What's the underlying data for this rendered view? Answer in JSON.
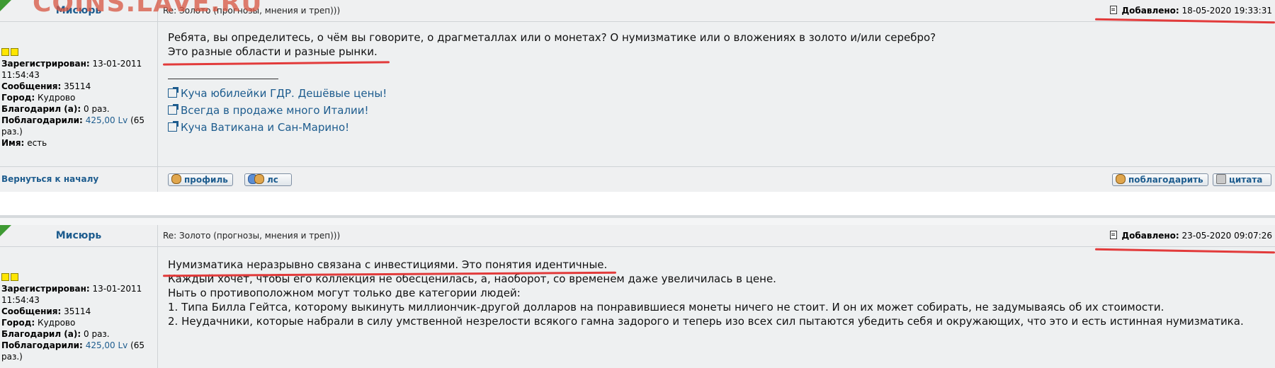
{
  "watermark": {
    "text": "COINS.LAVE.RU"
  },
  "posts": [
    {
      "author": "Мисюрь",
      "subject": "Re: Золото (прогнозы, мнения и треп)))",
      "date_label": "Добавлено:",
      "date": "18-05-2020 19:33:31",
      "profile": {
        "registered_label": "Зарегистрирован:",
        "registered_date": "13-01-2011",
        "registered_time": "11:54:43",
        "messages_label": "Сообщения:",
        "messages": "35114",
        "city_label": "Город:",
        "city": "Кудрово",
        "thanked_label": "Благодарил (а):",
        "thanked": "0 раз.",
        "was_thanked_label": "Поблагодарили:",
        "was_thanked_amount": "425,00 Lv",
        "was_thanked_count": "(65 раз.)",
        "name_label": "Имя:",
        "name": "есть"
      },
      "lines": [
        "Ребята, вы определитесь, о чём вы говорите, о драгметаллах или о монетах? О нумизматике или о вложениях в золото и/или серебро?",
        "Это разные области и разные рынки."
      ],
      "signature_links": [
        "Куча юбилейки ГДР. Дешёвые цены!",
        "Всегда в продаже много Италии!",
        "Куча Ватикана и Сан-Марино!"
      ],
      "footer": {
        "back_link": "Вернуться к началу",
        "profile_button": "профиль",
        "pm_button": "лс",
        "thank_button": "поблагодарить",
        "quote_button": "цитата"
      }
    },
    {
      "author": "Мисюрь",
      "subject": "Re: Золото (прогнозы, мнения и треп)))",
      "date_label": "Добавлено:",
      "date": "23-05-2020 09:07:26",
      "profile": {
        "registered_label": "Зарегистрирован:",
        "registered_date": "13-01-2011",
        "registered_time": "11:54:43",
        "messages_label": "Сообщения:",
        "messages": "35114",
        "city_label": "Город:",
        "city": "Кудрово",
        "thanked_label": "Благодарил (а):",
        "thanked": "0 раз.",
        "was_thanked_label": "Поблагодарили:",
        "was_thanked_amount": "425,00 Lv",
        "was_thanked_count": "(65 раз.)"
      },
      "lines": [
        "Нумизматика неразрывно связана с инвестициями. Это понятия идентичные.",
        "Каждый хочет, чтобы его коллекция не обесценилась, а, наоборот, со временем даже увеличилась в цене.",
        "Ныть о противоположном могут только две категории людей:",
        "1. Типа Билла Гейтса, которому выкинуть миллиончик-другой долларов на понравившиеся монеты ничего не стоит. И он их может собирать, не задумываясь об их стоимости.",
        "2. Неудачники, которые набрали в силу умственной незрелости всякого гамна задорого и теперь изо всех сил пытаются убедить себя и окружающих, что это и есть истинная нумизматика."
      ]
    }
  ],
  "colors": {
    "link": "#1d5c8e",
    "panel": "#eef0f1",
    "annotation": "#e23b3b",
    "watermark": "#d75a46"
  }
}
